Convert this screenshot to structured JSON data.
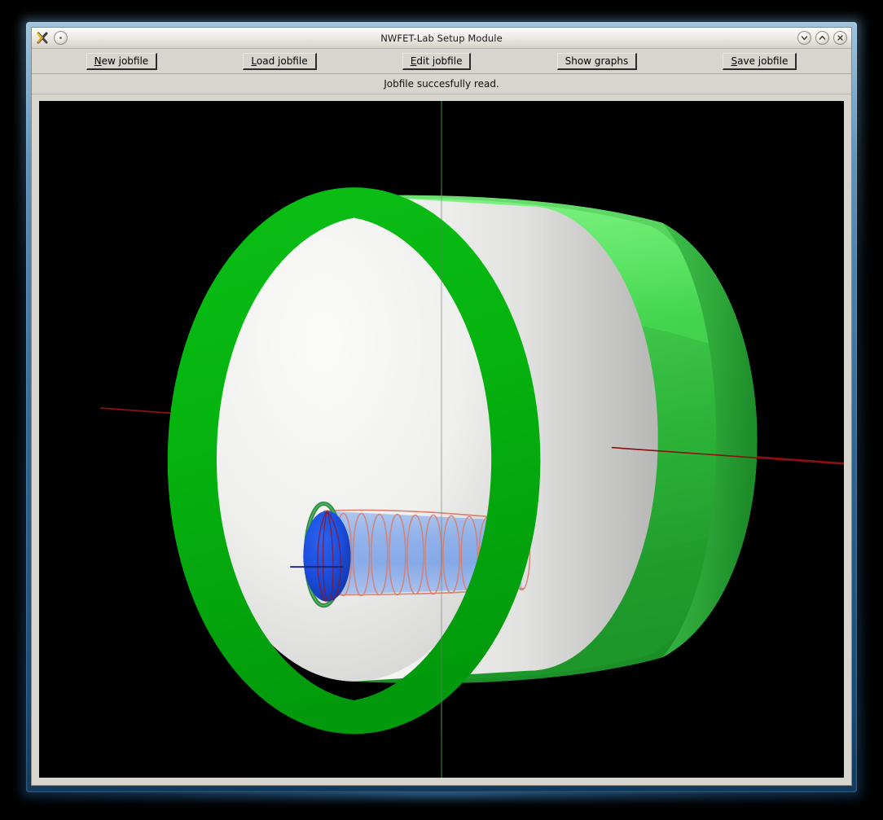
{
  "window": {
    "title": "NWFET-Lab Setup Module",
    "app_icon": "application-icon",
    "shade_button": "shade-icon",
    "controls": [
      {
        "name": "minimize-button",
        "icon": "chevron-down-icon"
      },
      {
        "name": "maximize-button",
        "icon": "chevron-up-icon"
      },
      {
        "name": "close-button",
        "icon": "close-icon"
      }
    ]
  },
  "toolbar": {
    "buttons": [
      {
        "name": "new-jobfile-button",
        "mnemonic": "N",
        "rest": "ew jobfile"
      },
      {
        "name": "load-jobfile-button",
        "mnemonic": "L",
        "rest": "oad jobfile"
      },
      {
        "name": "edit-jobfile-button",
        "mnemonic": "E",
        "rest": "dit jobfile"
      },
      {
        "name": "show-graphs-button",
        "pre": "Show ",
        "mnemonic": "g",
        "rest": "raphs"
      },
      {
        "name": "save-jobfile-button",
        "mnemonic": "S",
        "rest": "ave jobfile"
      }
    ]
  },
  "status": {
    "message": "Jobfile succesfully read."
  },
  "viewport": {
    "name": "3d-device-viewport",
    "background": "#000000",
    "scene_description": "3D gate-all-around nanowire FET device rendering",
    "objects": [
      {
        "name": "gate-cylinder",
        "label": "Gate",
        "color": "#00b300",
        "translucent": true
      },
      {
        "name": "oxide-cylinder",
        "label": "Oxide",
        "color": "#ededeb",
        "translucent": false
      },
      {
        "name": "nanowire-core",
        "label": "Nanowire",
        "color": "#6f9ae8",
        "translucent": true
      },
      {
        "name": "nanowire-endcap",
        "label": "Wire end",
        "color": "#1340d8",
        "translucent": false
      },
      {
        "name": "mesh-rings",
        "label": "Mesh rings",
        "color": "#d9806e",
        "translucent": false
      },
      {
        "name": "contact-ring",
        "label": "Contact ring",
        "color": "#2f8a3f",
        "translucent": false
      }
    ],
    "axes": [
      {
        "name": "x-axis-line",
        "color": "#8b1010",
        "orientation": "horizontal"
      },
      {
        "name": "y-axis-line",
        "color": "#2d5a2d",
        "orientation": "vertical"
      },
      {
        "name": "z-axis-line",
        "color": "#18227a",
        "orientation": "short-horizontal"
      }
    ]
  }
}
